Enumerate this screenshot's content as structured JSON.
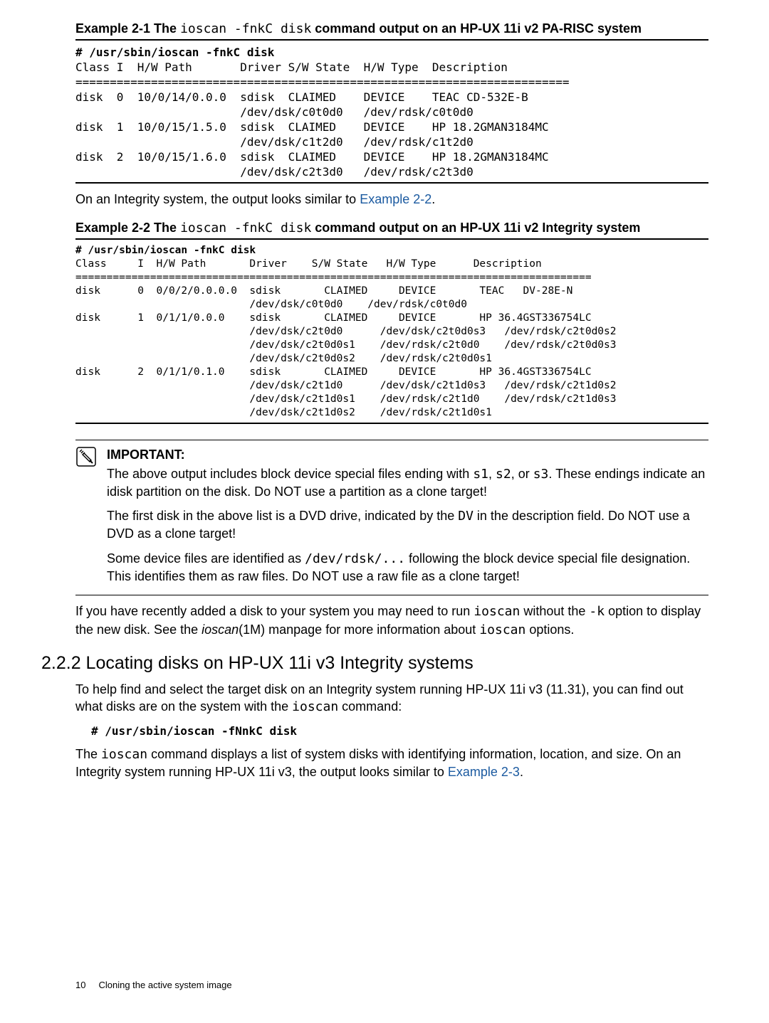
{
  "example1": {
    "title_prefix": "Example 2-1 The ",
    "title_code": "ioscan -fnkC disk",
    "title_suffix": " command output on an HP-UX 11i v2 PA-RISC system",
    "cmdline": "# /usr/sbin/ioscan -fnkC disk",
    "output": "Class I  H/W Path       Driver S/W State  H/W Type  Description\n========================================================================\ndisk  0  10/0/14/0.0.0  sdisk  CLAIMED    DEVICE    TEAC CD-532E-B\n                        /dev/dsk/c0t0d0   /dev/rdsk/c0t0d0\ndisk  1  10/0/15/1.5.0  sdisk  CLAIMED    DEVICE    HP 18.2GMAN3184MC\n                        /dev/dsk/c1t2d0   /dev/rdsk/c1t2d0\ndisk  2  10/0/15/1.6.0  sdisk  CLAIMED    DEVICE    HP 18.2GMAN3184MC\n                        /dev/dsk/c2t3d0   /dev/rdsk/c2t3d0"
  },
  "inter1": {
    "text_pre": "On an Integrity system, the output looks similar to ",
    "link": "Example 2-2",
    "text_post": "."
  },
  "example2": {
    "title_prefix": "Example 2-2 The ",
    "title_code": "ioscan -fnkC disk",
    "title_suffix": " command output on an HP-UX 11i v2 Integrity system",
    "cmdline": "# /usr/sbin/ioscan -fnkC disk",
    "output": "Class     I  H/W Path       Driver    S/W State   H/W Type      Description\n===================================================================================\ndisk      0  0/0/2/0.0.0.0  sdisk       CLAIMED     DEVICE       TEAC   DV-28E-N\n                            /dev/dsk/c0t0d0    /dev/rdsk/c0t0d0\ndisk      1  0/1/1/0.0.0    sdisk       CLAIMED     DEVICE       HP 36.4GST336754LC\n                            /dev/dsk/c2t0d0      /dev/dsk/c2t0d0s3   /dev/rdsk/c2t0d0s2\n                            /dev/dsk/c2t0d0s1    /dev/rdsk/c2t0d0    /dev/rdsk/c2t0d0s3\n                            /dev/dsk/c2t0d0s2    /dev/rdsk/c2t0d0s1\ndisk      2  0/1/1/0.1.0    sdisk       CLAIMED     DEVICE       HP 36.4GST336754LC\n                            /dev/dsk/c2t1d0      /dev/dsk/c2t1d0s3   /dev/rdsk/c2t1d0s2\n                            /dev/dsk/c2t1d0s1    /dev/rdsk/c2t1d0    /dev/rdsk/c2t1d0s3\n                            /dev/dsk/c2t1d0s2    /dev/rdsk/c2t1d0s1"
  },
  "important": {
    "label": "IMPORTANT:",
    "p1_a": "The above output includes block device special files ending with ",
    "p1_c1": "s1",
    "p1_b": ", ",
    "p1_c2": "s2",
    "p1_c": ", or ",
    "p1_c3": "s3",
    "p1_d": ". These endings indicate an idisk partition on the disk. Do NOT use a partition as a clone target!",
    "p2_a": "The first disk in the above list is a DVD drive, indicated by the ",
    "p2_c": "DV",
    "p2_b": " in the description field. Do NOT use a DVD as a clone target!",
    "p3_a": "Some device files are identified as ",
    "p3_c": "/dev/rdsk/...",
    "p3_b": " following the block device special file designation. This identifies them as raw files. Do NOT use a raw file as a clone target!"
  },
  "after_imp": {
    "a": "If you have recently added a disk to your system you may need to run ",
    "c1": "ioscan",
    "b": " without the ",
    "c2": "-k",
    "c": " option to display the new disk. See the ",
    "it": "ioscan",
    "d": "(1M) manpage for more information about ",
    "c3": "ioscan",
    "e": " options."
  },
  "section": {
    "title": "2.2.2 Locating disks on HP-UX 11i v3 Integrity systems",
    "p1_a": "To help find and select the target disk on an Integrity system running HP-UX 11i v3 (11.31), you can find out what disks are on the system with the ",
    "p1_c": "ioscan",
    "p1_b": " command:",
    "cmd": "# /usr/sbin/ioscan -fNnkC disk",
    "p2_a": "The ",
    "p2_c": "ioscan",
    "p2_b": " command displays a list of system disks with identifying information, location, and size. On an Integrity system running HP-UX 11i v3, the output looks similar to ",
    "p2_link": "Example 2-3",
    "p2_d": "."
  },
  "footer": {
    "pagenum": "10",
    "title": "Cloning the active system image"
  }
}
